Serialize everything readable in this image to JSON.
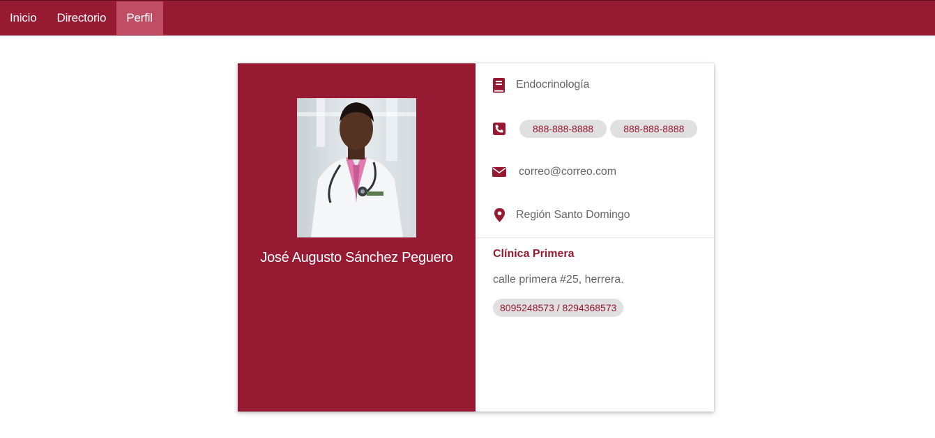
{
  "nav": {
    "items": [
      {
        "label": "Inicio",
        "active": false
      },
      {
        "label": "Directorio",
        "active": false
      },
      {
        "label": "Perfil",
        "active": true
      }
    ]
  },
  "colors": {
    "brand": "#961a31",
    "nav_active": "#c04d66",
    "pill_bg": "#e0e0e0",
    "muted_text": "#666666"
  },
  "profile": {
    "name": "José Augusto Sánchez Peguero",
    "photo_icon": "doctor-photo",
    "specialty_icon": "book-icon",
    "specialty": "Endocrinología",
    "phone_icon": "phone-icon",
    "phones": [
      "888-888-8888",
      "888-888-8888"
    ],
    "email_icon": "envelope-icon",
    "email": "correo@correo.com",
    "location_icon": "map-marker-icon",
    "region": "Región Santo Domingo"
  },
  "clinic": {
    "name": "Clínica Primera",
    "address": "calle primera #25, herrera.",
    "phones": "8095248573 / 8294368573"
  }
}
